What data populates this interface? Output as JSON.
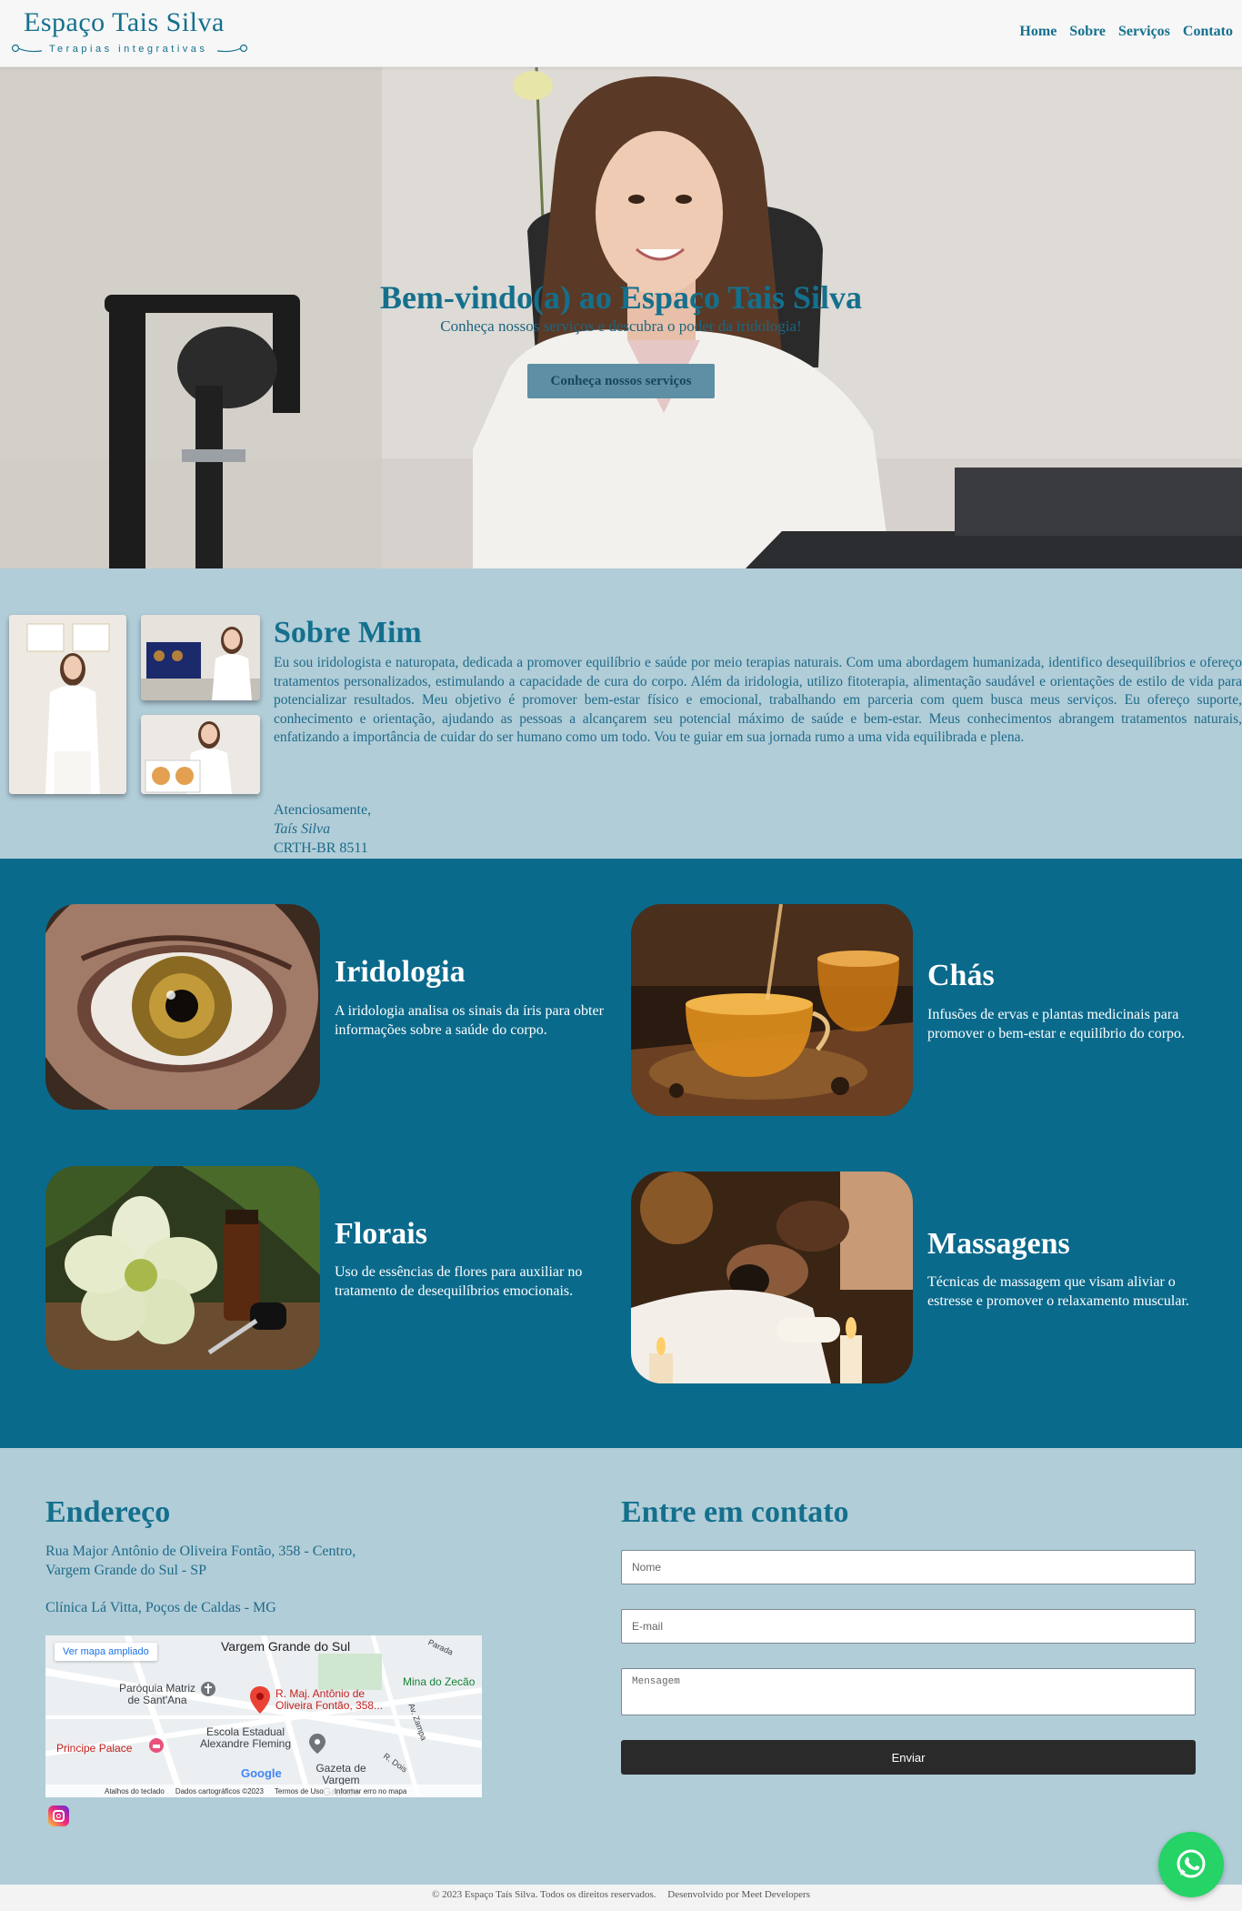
{
  "header": {
    "logo_title": "Espaço Tais Silva",
    "logo_subtitle": "Terapias integrativas",
    "nav": [
      "Home",
      "Sobre",
      "Serviços",
      "Contato"
    ]
  },
  "hero": {
    "title": "Bem-vindo(a) ao Espaço Tais Silva",
    "subtitle": "Conheça nossos serviços e descubra o poder da iridologia!",
    "button": "Conheça nossos serviços"
  },
  "about": {
    "title": "Sobre Mim",
    "text": "Eu sou iridologista e naturopata, dedicada a promover equilíbrio e saúde por meio terapias naturais. Com uma abordagem humanizada, identifico desequilíbrios e ofereço tratamentos personalizados, estimulando a capacidade de cura do corpo. Além da iridologia, utilizo fitoterapia, alimentação saudável e orientações de estilo de vida para potencializar resultados. Meu objetivo é promover bem-estar físico e emocional, trabalhando em parceria com quem busca meus serviços. Eu ofereço suporte, conhecimento e orientação, ajudando as pessoas a alcançarem seu potencial máximo de saúde e bem-estar. Meus conhecimentos abrangem tratamentos naturais, enfatizando a importância de cuidar do ser humano como um todo. Vou te guiar em sua jornada rumo a uma vida equilibrada e plena.",
    "signoff": "Atenciosamente,",
    "name": "Taís Silva",
    "registration": "CRTH-BR 8511"
  },
  "services": [
    {
      "title": "Iridologia",
      "desc": "A iridologia analisa os sinais da íris para obter informações sobre a saúde do corpo."
    },
    {
      "title": "Chás",
      "desc": "Infusões de ervas e plantas medicinais para promover o bem-estar e equilíbrio do corpo."
    },
    {
      "title": "Florais",
      "desc": "Uso de essências de flores para auxiliar no tratamento de desequilíbrios emocionais."
    },
    {
      "title": "Massagens",
      "desc": "Técnicas de massagem que visam aliviar o estresse e promover o relaxamento muscular."
    }
  ],
  "address": {
    "title": "Endereço",
    "line1": "Rua Major Antônio de Oliveira Fontão, 358 - Centro,",
    "line2": "Vargem Grande do Sul - SP",
    "line3": "Clínica Lá Vitta, Poços de Caldas - MG",
    "map": {
      "link": "Ver mapa ampliado",
      "city": "Vargem Grande do Sul",
      "church": "Paróquia Matriz de Sant'Ana",
      "pin": "R. Maj. Antônio de Oliveira Fontão, 358...",
      "hotel": "Principe Palace",
      "school": "Escola Estadual Alexandre Fleming",
      "shop": "Mina do Zecão",
      "news": "Gazeta de Vargem Grande",
      "road1": "Parada",
      "road2": "Av. Zampa",
      "road3": "R. Dois",
      "brand": "Google",
      "footer": [
        "Atalhos do teclado",
        "Dados cartográficos ©2023",
        "Termos de Uso",
        "Informar erro no mapa"
      ]
    }
  },
  "contact": {
    "title": "Entre em contato",
    "name_placeholder": "Nome",
    "email_placeholder": "E-mail",
    "message_placeholder": "Mensagem",
    "submit": "Enviar"
  },
  "footer": {
    "copyright": "© 2023 Espaço Taís Silva. Todos os direitos reservados.",
    "credits": "Desenvolvido por Meet Developers"
  },
  "colors": {
    "primary": "#14708d",
    "services_bg": "#0a6a8c",
    "section_bg": "#b1cdd8",
    "whatsapp": "#25d366"
  }
}
